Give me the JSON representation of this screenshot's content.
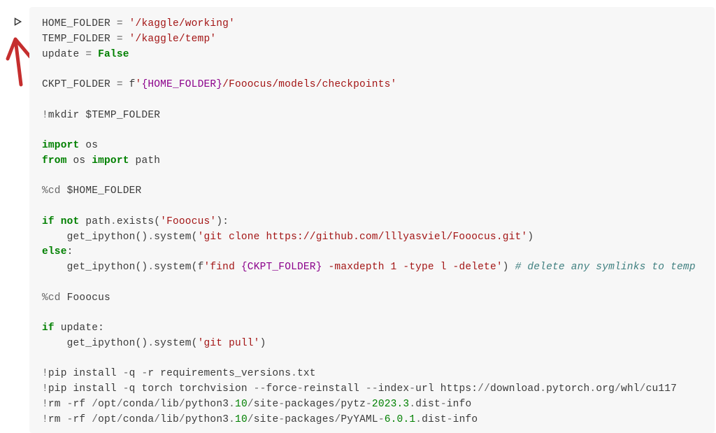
{
  "annotation": {
    "arrow_stroke": "#c52e2e"
  },
  "run_icon": "play",
  "code": {
    "l1_var": "HOME_FOLDER ",
    "l1_eq": "= ",
    "l1_str": "'/kaggle/working'",
    "l2_var": "TEMP_FOLDER ",
    "l2_eq": "= ",
    "l2_str": "'/kaggle/temp'",
    "l3_var": "update ",
    "l3_eq": "= ",
    "l3_kw": "False",
    "l5_var": "CKPT_FOLDER ",
    "l5_eq": "= ",
    "l5_pfx": "f",
    "l5_s1": "'",
    "l5_s2": "{HOME_FOLDER}",
    "l5_s3": "/Fooocus/models/checkpoints'",
    "l7_bang": "!",
    "l7_txt": "mkdir $TEMP_FOLDER",
    "l9_import": "import",
    "l9_sp": " os",
    "l10_from": "from",
    "l10_os": " os ",
    "l10_import": "import",
    "l10_path": " path",
    "l12_mag": "%cd ",
    "l12_txt": "$HOME_FOLDER",
    "l14_if": "if",
    "l14_sp": " ",
    "l14_not": "not",
    "l14_rest": " path",
    "l14_dot": ".",
    "l14_fn": "exists",
    "l14_p1": "(",
    "l14_str": "'Fooocus'",
    "l14_p2": "):",
    "l15_ind": "    get_ipython()",
    "l15_dot": ".",
    "l15_fn": "system",
    "l15_p1": "(",
    "l15_str": "'git clone https://github.com/lllyasviel/Fooocus.git'",
    "l15_p2": ")",
    "l16_else": "else",
    "l16_c": ":",
    "l17_ind": "    get_ipython()",
    "l17_dot": ".",
    "l17_fn": "system",
    "l17_p1": "(",
    "l17_pfx": "f",
    "l17_s1": "'find ",
    "l17_s2": "{CKPT_FOLDER}",
    "l17_s3": " -maxdepth 1 -type l -delete'",
    "l17_p2": ") ",
    "l17_cmt": "# delete any symlinks to temp",
    "l19_mag": "%cd ",
    "l19_txt": "Fooocus",
    "l21_if": "if",
    "l21_txt": " update:",
    "l22_ind": "    get_ipython()",
    "l22_dot": ".",
    "l22_fn": "system",
    "l22_p1": "(",
    "l22_str": "'git pull'",
    "l22_p2": ")",
    "l24_bang": "!",
    "l24_a": "pip install ",
    "l24_op1": "-",
    "l24_b": "q ",
    "l24_op2": "-",
    "l24_c": "r requirements_versions",
    "l24_d": ".",
    "l24_e": "txt",
    "l25_bang": "!",
    "l25_a": "pip install ",
    "l25_op1": "-",
    "l25_b": "q torch torchvision ",
    "l25_op2": "--",
    "l25_c": "force",
    "l25_op3": "-",
    "l25_d": "reinstall ",
    "l25_op4": "--",
    "l25_e": "index",
    "l25_op5": "-",
    "l25_f": "url https:",
    "l25_g": "//",
    "l25_h": "download",
    "l25_i": ".",
    "l25_j": "pytorch",
    "l25_k": ".",
    "l25_l": "org",
    "l25_m": "/",
    "l25_n": "whl",
    "l25_o": "/",
    "l25_p": "cu117",
    "l26_bang": "!",
    "l26_a": "rm ",
    "l26_op1": "-",
    "l26_b": "rf ",
    "l26_c": "/",
    "l26_d": "opt",
    "l26_e": "/",
    "l26_f": "conda",
    "l26_g": "/",
    "l26_h": "lib",
    "l26_i": "/",
    "l26_j": "python3",
    "l26_k": ".",
    "l26_l": "10",
    "l26_m": "/",
    "l26_n": "site",
    "l26_o": "-",
    "l26_p": "packages",
    "l26_q": "/",
    "l26_r": "pytz",
    "l26_s": "-",
    "l26_t": "2023.3",
    "l26_u": ".",
    "l26_v": "dist",
    "l26_w": "-",
    "l26_x": "info",
    "l27_bang": "!",
    "l27_a": "rm ",
    "l27_op1": "-",
    "l27_b": "rf ",
    "l27_c": "/",
    "l27_d": "opt",
    "l27_e": "/",
    "l27_f": "conda",
    "l27_g": "/",
    "l27_h": "lib",
    "l27_i": "/",
    "l27_j": "python3",
    "l27_k": ".",
    "l27_l": "10",
    "l27_m": "/",
    "l27_n": "site",
    "l27_o": "-",
    "l27_p": "packages",
    "l27_q": "/",
    "l27_r": "PyYAML",
    "l27_s": "-",
    "l27_t": "6.0.1",
    "l27_u": ".",
    "l27_v": "dist",
    "l27_w": "-",
    "l27_x": "info"
  }
}
